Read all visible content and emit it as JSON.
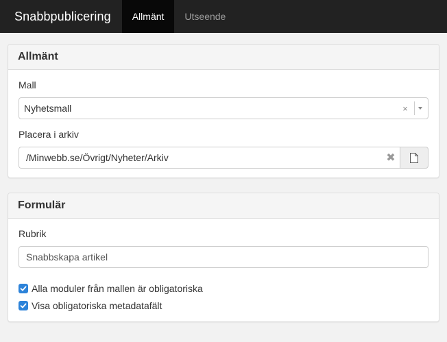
{
  "navbar": {
    "brand": "Snabbpublicering",
    "tabs": [
      {
        "label": "Allmänt",
        "active": true
      },
      {
        "label": "Utseende",
        "active": false
      }
    ]
  },
  "general_panel": {
    "title": "Allmänt",
    "template": {
      "label": "Mall",
      "value": "Nyhetsmall",
      "clear_glyph": "×"
    },
    "archive": {
      "label": "Placera i arkiv",
      "value": "/Minwebb.se/Övrigt/Nyheter/Arkiv",
      "clear_glyph": "✖",
      "browse_icon": "document-icon"
    }
  },
  "form_panel": {
    "title": "Formulär",
    "heading": {
      "label": "Rubrik",
      "value": "Snabbskapa artikel"
    },
    "checkboxes": [
      {
        "label": "Alla moduler från mallen är obligatoriska",
        "checked": true
      },
      {
        "label": "Visa obligatoriska metadatafält",
        "checked": true
      }
    ]
  },
  "colors": {
    "navbar_bg": "#222222",
    "active_tab_bg": "#080808",
    "checkbox_accent": "#2d83d9"
  }
}
